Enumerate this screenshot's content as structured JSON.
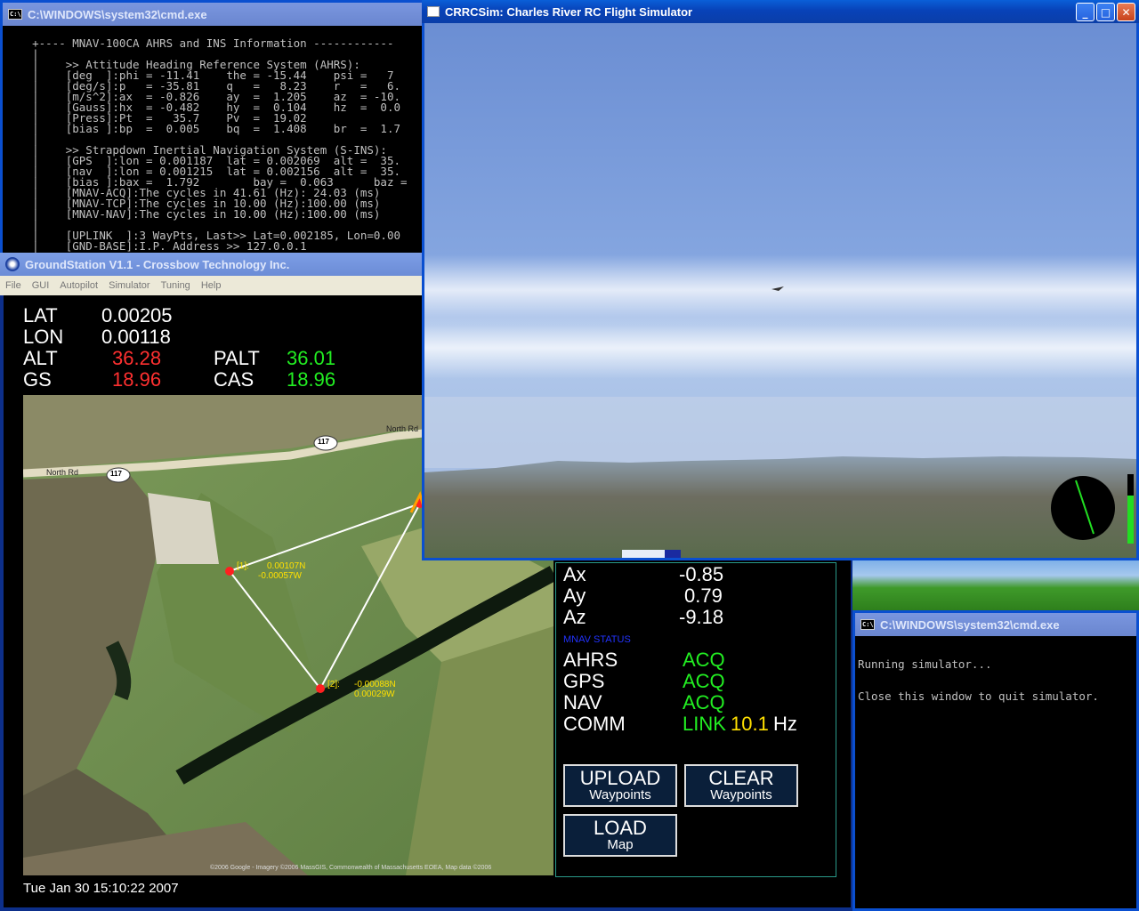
{
  "cmd_top": {
    "title": "C:\\WINDOWS\\system32\\cmd.exe",
    "lines": [
      "",
      "    +---- MNAV-100CA AHRS and INS Information ------------",
      "    |",
      "    |    >> Attitude Heading Reference System (AHRS):",
      "    |    [deg  ]:phi = -11.41    the = -15.44    psi =   7",
      "    |    [deg/s]:p   = -35.81    q   =   8.23    r   =   6.",
      "    |    [m/s^2]:ax  = -0.826    ay  =  1.205    az  = -10.",
      "    |    [Gauss]:hx  = -0.482    hy  =  0.104    hz  =  0.0",
      "    |    [Press]:Pt  =   35.7    Pv  =  19.02",
      "    |    [bias ]:bp  =  0.005    bq  =  1.408    br  =  1.7",
      "    |",
      "    |    >> Strapdown Inertial Navigation System (S-INS):",
      "    |    [GPS  ]:lon = 0.001187  lat = 0.002069  alt =  35.",
      "    |    [nav  ]:lon = 0.001215  lat = 0.002156  alt =  35.",
      "    |    [bias ]:bax =  1.792        bay =  0.063      baz =",
      "    |    [MNAV-ACQ]:The cycles in 41.61 (Hz): 24.03 (ms)",
      "    |    [MNAV-TCP]:The cycles in 10.00 (Hz):100.00 (ms)",
      "    |    [MNAV-NAV]:The cycles in 10.00 (Hz):100.00 (ms)",
      "    |",
      "    |    [UPLINK  ]:3 WayPts, Last>> Lat=0.002185, Lon=0.00",
      "    |    [GND-BASE]:I.P. Address >> 127.0.0.1"
    ]
  },
  "groundstation": {
    "title": "GroundStation V1.1 - Crossbow Technology Inc.",
    "menu": [
      "File",
      "GUI",
      "Autopilot",
      "Simulator",
      "Tuning",
      "Help"
    ],
    "lat_label": "LAT",
    "lat_value": "0.00205",
    "lon_label": "LON",
    "lon_value": "0.00118",
    "alt_label": "ALT",
    "alt_value": "36.28",
    "palt_label": "PALT",
    "palt_value": "36.01",
    "gs_label": "GS",
    "gs_value": "18.96",
    "cas_label": "CAS",
    "cas_value": "18.96",
    "ax_label": "Ax",
    "ax_value": "-0.85",
    "ay_label": "Ay",
    "ay_value": "0.79",
    "az_label": "Az",
    "az_value": "-9.18",
    "mnav_status_label": "MNAV STATUS",
    "status": [
      {
        "label": "AHRS",
        "value": "ACQ"
      },
      {
        "label": "GPS",
        "value": "ACQ"
      },
      {
        "label": "NAV",
        "value": "ACQ"
      },
      {
        "label": "COMM",
        "value": "LINK"
      }
    ],
    "comm_rate": "10.1",
    "comm_unit": "Hz",
    "upload_l1": "UPLOAD",
    "upload_l2": "Waypoints",
    "clear_l1": "CLEAR",
    "clear_l2": "Waypoints",
    "load_l1": "LOAD",
    "load_l2": "Map",
    "timestamp": "Tue Jan 30 15:10:22 2007",
    "map": {
      "road_label_1": "North Rd",
      "road_label_2": "North Rd",
      "route_shield": "117",
      "wp1_label": "[1]:",
      "wp1_coords_1": "0.00107N",
      "wp1_coords_2": "-0.00057W",
      "wp2_label": "[2]:",
      "wp2_coords_1": "-0.00088N",
      "wp2_coords_2": "0.00029W",
      "copyright": "©2006 Google - Imagery ©2006 MassGIS, Commonwealth of Massachusetts EOEA, Map data ©2006"
    }
  },
  "sim": {
    "title": "CRRCSim: Charles River RC Flight Simulator"
  },
  "cmd_bottom": {
    "title": "C:\\WINDOWS\\system32\\cmd.exe",
    "line1": "Running simulator...",
    "line2": "Close this window to quit simulator."
  }
}
